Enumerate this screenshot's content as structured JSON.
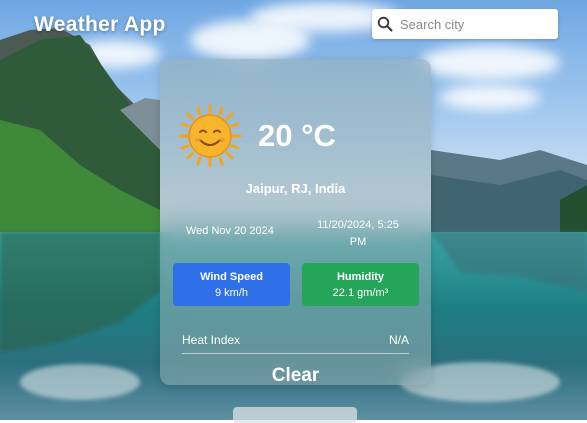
{
  "app": {
    "title": "Weather App"
  },
  "search": {
    "placeholder": "Search city"
  },
  "weather": {
    "icon": "sun-smiley-icon",
    "temperature": "20 °C",
    "location": "Jaipur, RJ, India",
    "date": "Wed Nov 20 2024",
    "datetime": "11/20/2024, 5:25 PM",
    "wind": {
      "label": "Wind Speed",
      "value": "9 km/h"
    },
    "humidity": {
      "label": "Humidity",
      "value": "22.1 gm/m³"
    },
    "heat_index": {
      "label": "Heat Index",
      "value": "N/A"
    },
    "clear_label": "Clear"
  },
  "colors": {
    "wind_tile": "#2f6fe8",
    "humidity_tile": "#24a55a",
    "sun": "#f5b223"
  }
}
